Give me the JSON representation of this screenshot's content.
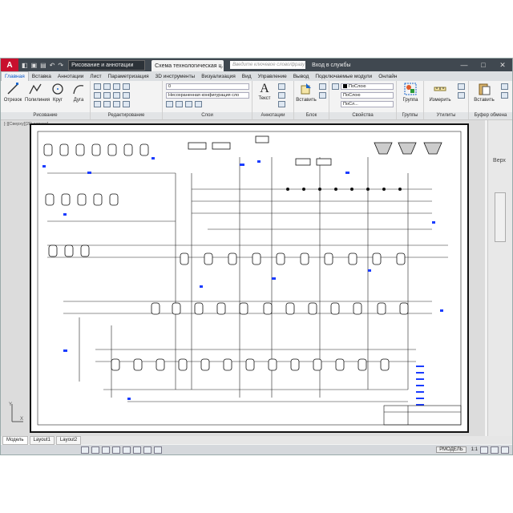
{
  "app": {
    "logo": "A",
    "quick_access": [
      "◧",
      "▣",
      "▤",
      "↶",
      "↷"
    ],
    "workspace": "Рисование и аннотации",
    "document_title": "Схема технологическая ц...",
    "search_placeholder": "Введите ключевое слово/фразу",
    "sign_in": "Вход в службы",
    "window_controls": [
      "—",
      "□",
      "✕"
    ]
  },
  "tabs": [
    "Главная",
    "Вставка",
    "Аннотации",
    "Лист",
    "Параметризация",
    "3D инструменты",
    "Визуализация",
    "Вид",
    "Управление",
    "Вывод",
    "Подключаемые модули",
    "Онлайн"
  ],
  "ribbon": {
    "draw": {
      "label": "Рисование",
      "tools": [
        "Отрезок",
        "Полилиния",
        "Круг",
        "Дуга"
      ]
    },
    "modify": {
      "label": "Редактирование"
    },
    "layers": {
      "label": "Слои",
      "current": "0",
      "state": "Несохраненная конфигурация сло"
    },
    "annotation": {
      "label": "Аннотации",
      "text_tool": "Текст"
    },
    "block": {
      "label": "Блок",
      "insert": "Вставить"
    },
    "properties": {
      "label": "Свойства",
      "color": "ПоСлою",
      "linetype": "ПоСлою",
      "lineweight": "ПоСл..."
    },
    "groups": {
      "label": "Группы",
      "tool": "Группа"
    },
    "utilities": {
      "label": "Утилиты",
      "tool": "Измерить"
    },
    "clipboard": {
      "label": "Буфер обмена",
      "tool": "Вставить"
    }
  },
  "view_label": "[-][Сверху][2D-каркас]",
  "navbar": {
    "cube": "Верх"
  },
  "layout_tabs": [
    "Модель",
    "Layout1",
    "Layout2"
  ],
  "status": {
    "model_button": "РМОДЕЛЬ",
    "scale": "1:1"
  },
  "colors": {
    "titlebar": "#404850",
    "accent_red": "#c8102e",
    "drawing_bg": "#dcdcdc",
    "sheet_line": "#111111",
    "highlight": "#1a3cff"
  }
}
